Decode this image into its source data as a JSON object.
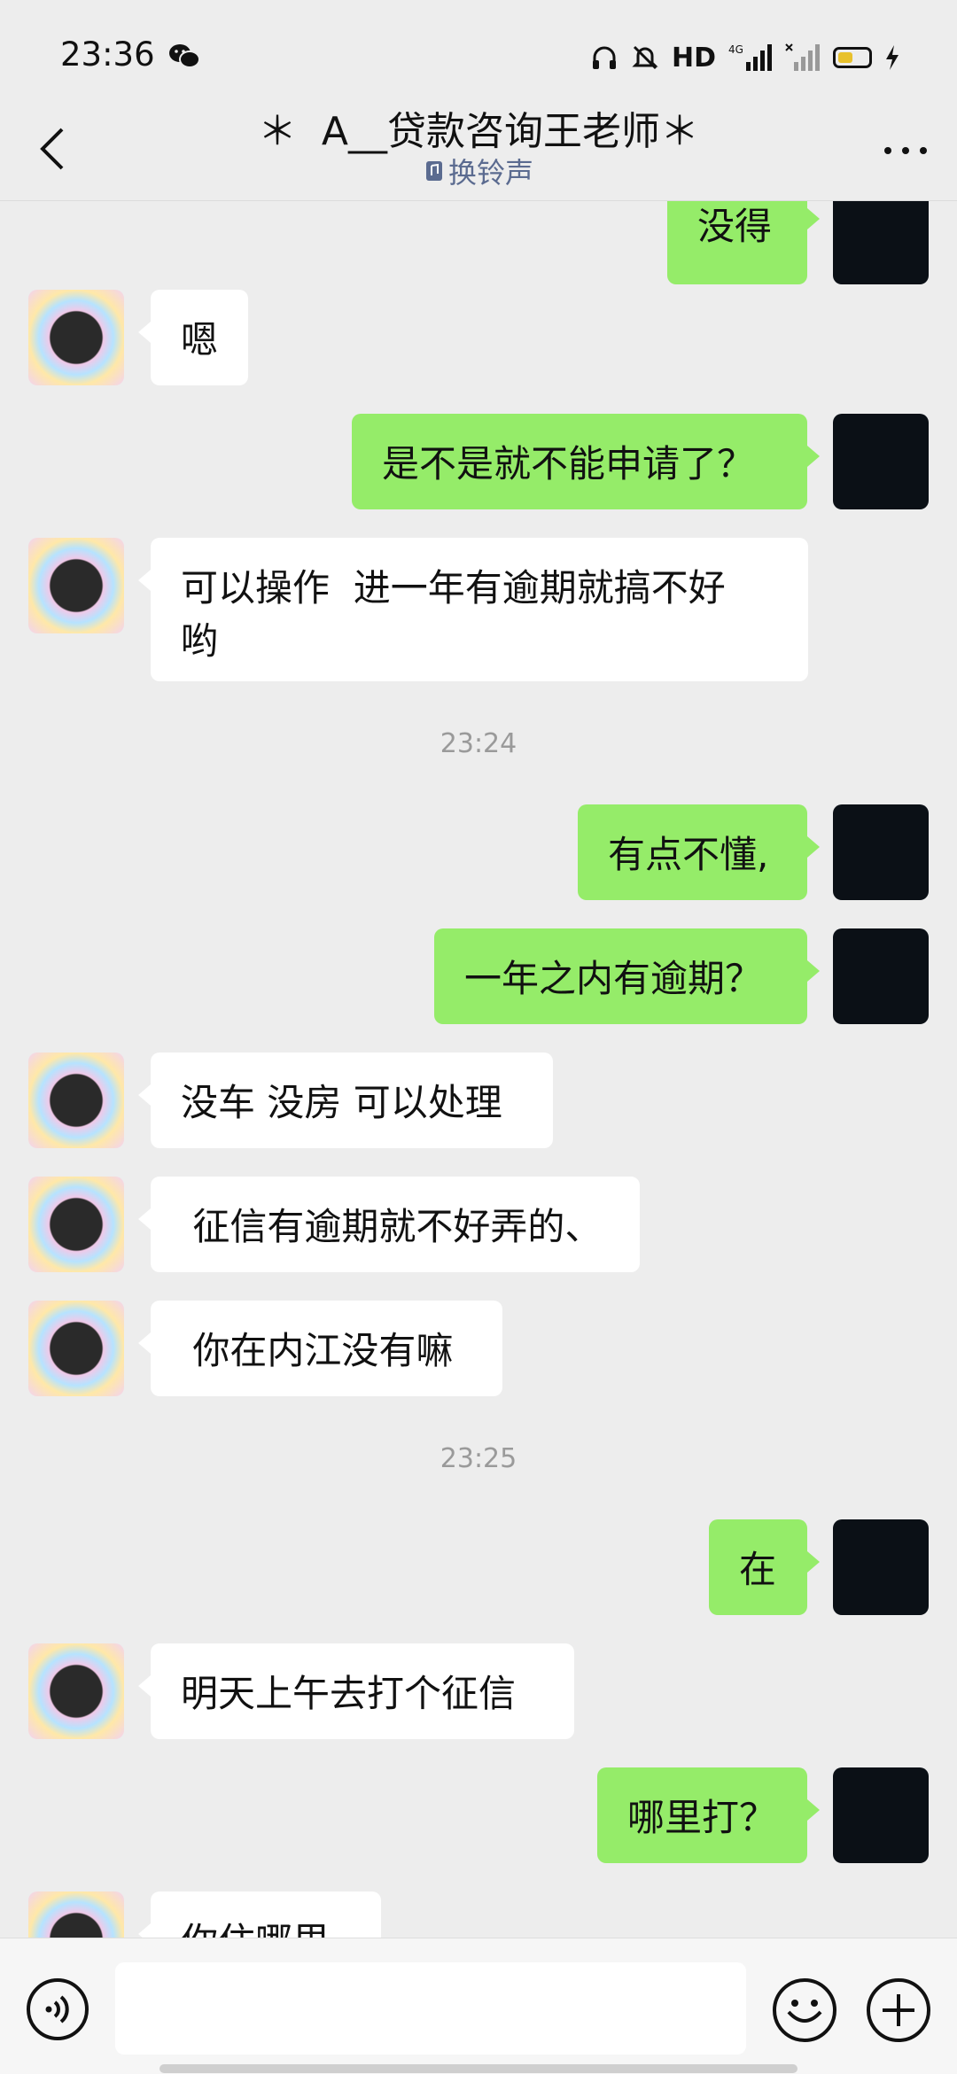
{
  "status_bar": {
    "time": "23:36",
    "network": "HD",
    "signal": "4G"
  },
  "header": {
    "title": "＊  A__贷款咨询王老师＊",
    "subtitle": "换铃声"
  },
  "messages": [
    {
      "from": "me",
      "text": "没得"
    },
    {
      "from": "them",
      "text": "嗯"
    },
    {
      "from": "me",
      "text": "是不是就不能申请了？"
    },
    {
      "from": "them",
      "text": "可以操作  进一年有逾期就搞不好\n哟"
    },
    {
      "from": "me",
      "text": "有点不懂,"
    },
    {
      "from": "me",
      "text": "一年之内有逾期？"
    },
    {
      "from": "them",
      "text": "没车 没房 可以处理"
    },
    {
      "from": "them",
      "text": " 征信有逾期就不好弄的、"
    },
    {
      "from": "them",
      "text": " 你在内江没有嘛"
    },
    {
      "from": "me",
      "text": "在"
    },
    {
      "from": "them",
      "text": "明天上午去打个征信"
    },
    {
      "from": "me",
      "text": "哪里打？"
    },
    {
      "from": "them",
      "text": "你住哪里"
    }
  ],
  "timestamps": [
    "23:24",
    "23:25"
  ],
  "input": {
    "value": "",
    "placeholder": ""
  },
  "icons": {
    "back": "chevron-left-icon",
    "more": "more-dots-icon",
    "voice": "voice-icon",
    "emoji": "emoji-icon",
    "plus": "plus-icon",
    "ringtone": "ringtone-icon",
    "wechat": "wechat-icon"
  },
  "colors": {
    "outgoing_bubble": "#95ec69",
    "incoming_bubble": "#ffffff",
    "background": "#ededed",
    "subtitle": "#5b6b90"
  }
}
